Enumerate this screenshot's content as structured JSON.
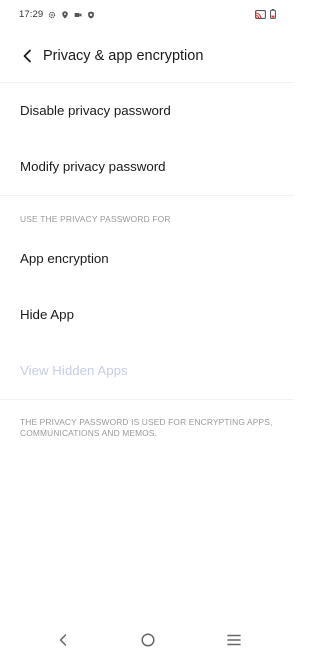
{
  "status_bar": {
    "time": "17:29"
  },
  "header": {
    "title": "Privacy & app encryption"
  },
  "items": {
    "disable_password": "Disable privacy password",
    "modify_password": "Modify privacy password"
  },
  "section": {
    "header": "USE THE PRIVACY PASSWORD FOR",
    "items": {
      "app_encryption": "App encryption",
      "hide_app": "Hide App",
      "view_hidden_apps": "View Hidden Apps"
    }
  },
  "footnote": "THE PRIVACY PASSWORD IS USED FOR ENCRYPTING APPS, COMMUNICATIONS AND MEMOS.",
  "colors": {
    "disabled_text": "#c5cde8",
    "secondary_text": "#9a9a9a",
    "battery_icon": "#e53935"
  },
  "icons": {
    "status": [
      "settings-icon",
      "location-icon",
      "video-icon",
      "shield-icon",
      "cast-icon",
      "battery-icon"
    ],
    "navigation": [
      "back-icon",
      "home-icon",
      "menu-icon"
    ]
  }
}
